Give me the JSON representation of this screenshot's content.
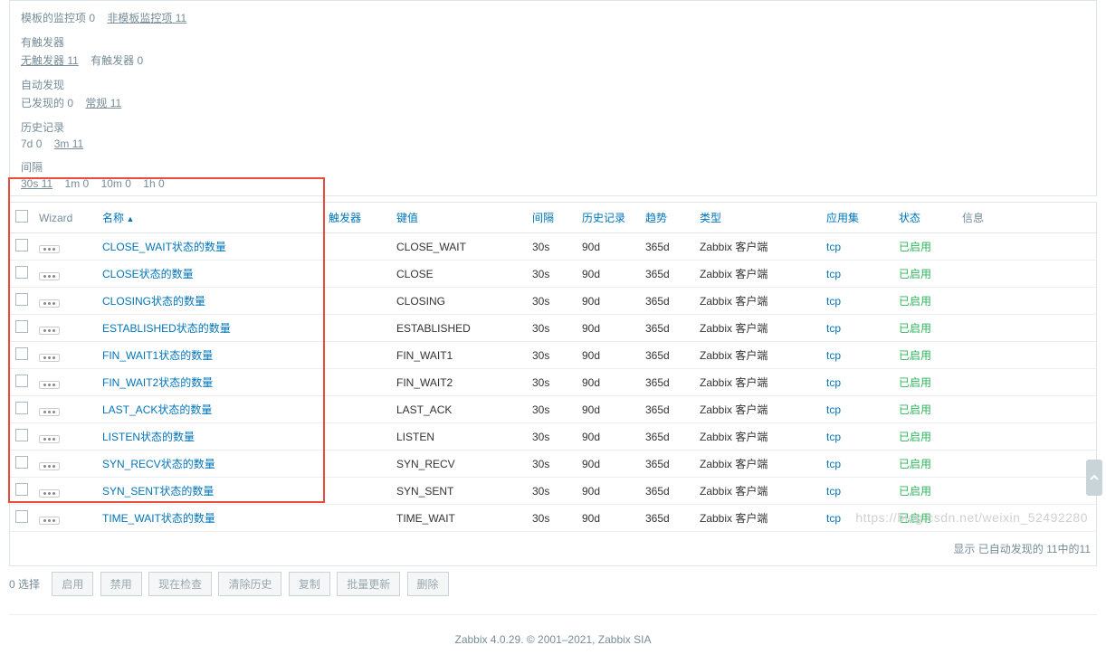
{
  "filters": {
    "template": {
      "label": "模板的监控项",
      "count": "0",
      "alt_label": "非模板监控项",
      "alt_count": "11"
    },
    "trigger": {
      "label": "有触发器",
      "no_label": "无触发器",
      "no_count": "11",
      "yes_label": "有触发器",
      "yes_count": "0"
    },
    "discovery": {
      "label": "自动发现",
      "found_label": "已发现的",
      "found_count": "0",
      "normal_label": "常规",
      "normal_count": "11"
    },
    "history": {
      "label": "历史记录",
      "d7_label": "7d",
      "d7_count": "0",
      "m3_label": "3m",
      "m3_count": "11"
    },
    "interval": {
      "label": "间隔",
      "i30s": "30s",
      "i30s_c": "11",
      "i1m": "1m",
      "i1m_c": "0",
      "i10m": "10m",
      "i10m_c": "0",
      "i1h": "1h",
      "i1h_c": "0"
    }
  },
  "columns": {
    "wizard": "Wizard",
    "name": "名称",
    "trigger": "触发器",
    "key": "键值",
    "interval": "间隔",
    "history": "历史记录",
    "trend": "趋势",
    "type": "类型",
    "app": "应用集",
    "status": "状态",
    "info": "信息"
  },
  "rows": [
    {
      "name": "CLOSE_WAIT状态的数量",
      "key": "CLOSE_WAIT",
      "interval": "30s",
      "history": "90d",
      "trend": "365d",
      "type": "Zabbix 客户端",
      "app": "tcp",
      "status": "已启用"
    },
    {
      "name": "CLOSE状态的数量",
      "key": "CLOSE",
      "interval": "30s",
      "history": "90d",
      "trend": "365d",
      "type": "Zabbix 客户端",
      "app": "tcp",
      "status": "已启用"
    },
    {
      "name": "CLOSING状态的数量",
      "key": "CLOSING",
      "interval": "30s",
      "history": "90d",
      "trend": "365d",
      "type": "Zabbix 客户端",
      "app": "tcp",
      "status": "已启用"
    },
    {
      "name": "ESTABLISHED状态的数量",
      "key": "ESTABLISHED",
      "interval": "30s",
      "history": "90d",
      "trend": "365d",
      "type": "Zabbix 客户端",
      "app": "tcp",
      "status": "已启用"
    },
    {
      "name": "FIN_WAIT1状态的数量",
      "key": "FIN_WAIT1",
      "interval": "30s",
      "history": "90d",
      "trend": "365d",
      "type": "Zabbix 客户端",
      "app": "tcp",
      "status": "已启用"
    },
    {
      "name": "FIN_WAIT2状态的数量",
      "key": "FIN_WAIT2",
      "interval": "30s",
      "history": "90d",
      "trend": "365d",
      "type": "Zabbix 客户端",
      "app": "tcp",
      "status": "已启用"
    },
    {
      "name": "LAST_ACK状态的数量",
      "key": "LAST_ACK",
      "interval": "30s",
      "history": "90d",
      "trend": "365d",
      "type": "Zabbix 客户端",
      "app": "tcp",
      "status": "已启用"
    },
    {
      "name": "LISTEN状态的数量",
      "key": "LISTEN",
      "interval": "30s",
      "history": "90d",
      "trend": "365d",
      "type": "Zabbix 客户端",
      "app": "tcp",
      "status": "已启用"
    },
    {
      "name": "SYN_RECV状态的数量",
      "key": "SYN_RECV",
      "interval": "30s",
      "history": "90d",
      "trend": "365d",
      "type": "Zabbix 客户端",
      "app": "tcp",
      "status": "已启用"
    },
    {
      "name": "SYN_SENT状态的数量",
      "key": "SYN_SENT",
      "interval": "30s",
      "history": "90d",
      "trend": "365d",
      "type": "Zabbix 客户端",
      "app": "tcp",
      "status": "已启用"
    },
    {
      "name": "TIME_WAIT状态的数量",
      "key": "TIME_WAIT",
      "interval": "30s",
      "history": "90d",
      "trend": "365d",
      "type": "Zabbix 客户端",
      "app": "tcp",
      "status": "已启用"
    }
  ],
  "footer_count": "显示 已自动发现的 11中的11",
  "actions": {
    "selected_prefix": "0",
    "selected_label": "选择",
    "enable": "启用",
    "disable": "禁用",
    "checknow": "现在检查",
    "clearhist": "清除历史",
    "copy": "复制",
    "massupdate": "批量更新",
    "delete": "删除"
  },
  "zabbix_footer": "Zabbix 4.0.29. © 2001–2021, Zabbix SIA",
  "watermark": "https://blog.csdn.net/weixin_52492280"
}
